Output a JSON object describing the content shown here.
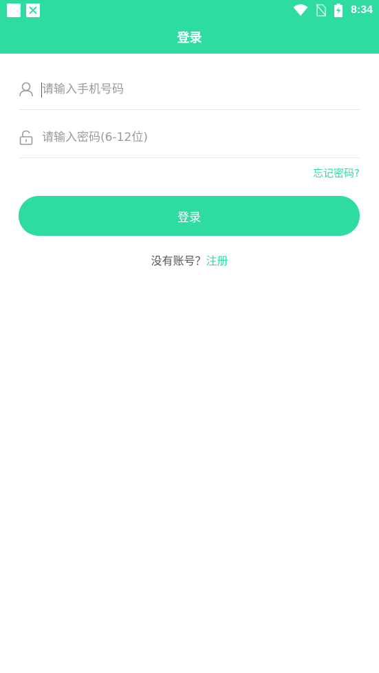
{
  "status_bar": {
    "time": "8:34"
  },
  "app_bar": {
    "title": "登录"
  },
  "form": {
    "phone_placeholder": "请输入手机号码",
    "phone_value": "",
    "password_placeholder": "请输入密码(6-12位)",
    "password_value": "",
    "forgot_label": "忘记密码?",
    "login_label": "登录",
    "register_prompt": "没有账号？",
    "register_label": "注册"
  },
  "colors": {
    "accent": "#2edca3",
    "placeholder": "#9a9a9a",
    "divider": "#e8e8e8"
  }
}
